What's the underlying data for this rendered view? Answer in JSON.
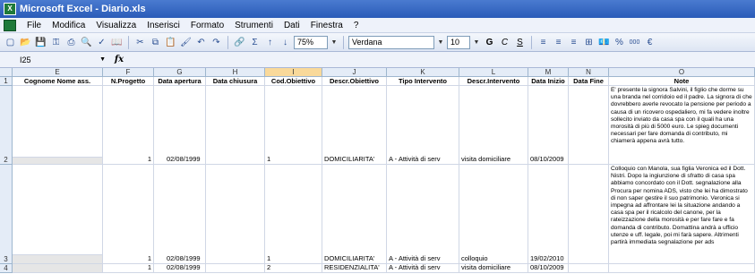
{
  "window": {
    "title": "Microsoft Excel - Diario.xls"
  },
  "menu": [
    "File",
    "Modifica",
    "Visualizza",
    "Inserisci",
    "Formato",
    "Strumenti",
    "Dati",
    "Finestra",
    "?"
  ],
  "toolbar": {
    "zoom": "75%",
    "font": "Verdana",
    "size": "10",
    "bold": "G",
    "italic": "C",
    "underline": "S",
    "percent": "%",
    "thousands": "000",
    "currency": "€"
  },
  "formula": {
    "cell_ref": "I25",
    "fx": "fx",
    "content": ""
  },
  "columns": [
    "E",
    "F",
    "G",
    "H",
    "I",
    "J",
    "K",
    "L",
    "M",
    "N",
    "O"
  ],
  "headers": [
    "Cognome Nome ass.",
    "N.Progetto",
    "Data apertura",
    "Data chiusura",
    "Cod.Obiettivo",
    "Descr.Obiettivo",
    "Tipo Intervento",
    "Descr.Intervento",
    "Data Inizio",
    "Data Fine",
    "Note"
  ],
  "rows": [
    {
      "num": "1"
    },
    {
      "num": "2",
      "progetto": "1",
      "apertura": "02/08/1999",
      "chiusura": "",
      "cod": "1",
      "descr": "DOMICILIARITA'",
      "tipo": "A - Attività di serv",
      "intervento": "visita domiciliare",
      "inizio": "08/10/2009",
      "fine": "",
      "note": "E' presente la signora Salvini, il figlio che dorme su una branda nel corridoio ed il padre. La signora di che dovrebbero averle revocato la pensione per periodo a causa di un ricovero ospedaliero, mi fa vedere inoltre sollecito inviato da casa spa con il quali ha una morosità di più di 5000 euro. Le spieg documenti necessari per fare domanda di contributo, mi chiamerà appena avrà tutto."
    },
    {
      "num": "3",
      "progetto": "1",
      "apertura": "02/08/1999",
      "chiusura": "",
      "cod": "1",
      "descr": "DOMICILIARITA'",
      "tipo": "A - Attività di serv",
      "intervento": "colloquio",
      "inizio": "19/02/2010",
      "fine": "",
      "note": "Colloquio con Manola, sua figlia Veronica ed il Dott. Nistri. Dopo la ingiunzione di sfratto di casa spa abbiamo concordato con il Dott. segnalazione alla Procura per nomina ADS, visto che lei ha dimostrato di non saper gestire il suo patrimonio. Veronica si impegna ad affrontare lei la situazione andando a casa spa per il ricalcolo del canone, per la rateizzazione della morosità e per fare fare e fa domanda di contributo. Domattina andrà a ufficio utenze e uff. legale, poi mi farà sapere. Altrimenti partirà immediata segnalazione per ads"
    },
    {
      "num": "4",
      "progetto": "1",
      "apertura": "02/08/1999",
      "chiusura": "",
      "cod": "2",
      "descr": "RESIDENZIALITA'",
      "tipo": "A - Attività di serv",
      "intervento": "visita domiciliare",
      "inizio": "08/10/2009",
      "fine": "",
      "note": ""
    }
  ]
}
